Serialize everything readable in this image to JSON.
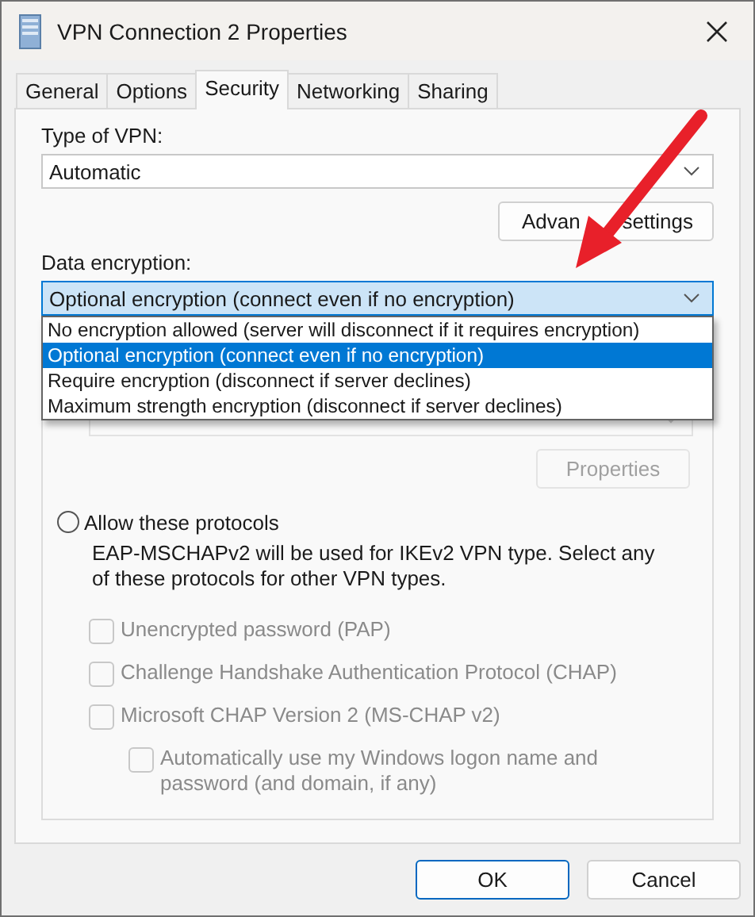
{
  "window": {
    "title": "VPN Connection 2 Properties"
  },
  "tabs": [
    {
      "label": "General",
      "selected": false
    },
    {
      "label": "Options",
      "selected": false
    },
    {
      "label": "Security",
      "selected": true
    },
    {
      "label": "Networking",
      "selected": false
    },
    {
      "label": "Sharing",
      "selected": false
    }
  ],
  "vpn_type": {
    "label": "Type of VPN:",
    "value": "Automatic"
  },
  "advanced_button": {
    "label_parts": [
      "Advan",
      "settings"
    ]
  },
  "data_encryption": {
    "label": "Data encryption:",
    "value": "Optional encryption (connect even if no encryption)",
    "expanded": true,
    "options": [
      {
        "label": "No encryption allowed (server will disconnect if it requires encryption)",
        "selected": false
      },
      {
        "label": "Optional encryption (connect even if no encryption)",
        "selected": true
      },
      {
        "label": "Require encryption (disconnect if server declines)",
        "selected": false
      },
      {
        "label": "Maximum strength encryption (disconnect if server declines)",
        "selected": false
      }
    ]
  },
  "authentication": {
    "eap_method": {
      "disabled": true
    },
    "properties_button": {
      "label": "Properties",
      "disabled": true
    },
    "allow_protocols": {
      "label": "Allow these protocols",
      "selected": false,
      "description": "EAP-MSCHAPv2 will be used for IKEv2 VPN type. Select any of these protocols for other VPN types."
    },
    "protocols": [
      {
        "label": "Unencrypted password (PAP)",
        "checked": false,
        "disabled": true
      },
      {
        "label": "Challenge Handshake Authentication Protocol (CHAP)",
        "checked": false,
        "disabled": true
      },
      {
        "label": "Microsoft CHAP Version 2 (MS-CHAP v2)",
        "checked": false,
        "disabled": true,
        "children": [
          {
            "label": "Automatically use my Windows logon name and password (and domain, if any)",
            "checked": false,
            "disabled": true
          }
        ]
      }
    ]
  },
  "buttons": [
    {
      "label": "OK",
      "default": true
    },
    {
      "label": "Cancel",
      "default": false
    }
  ]
}
